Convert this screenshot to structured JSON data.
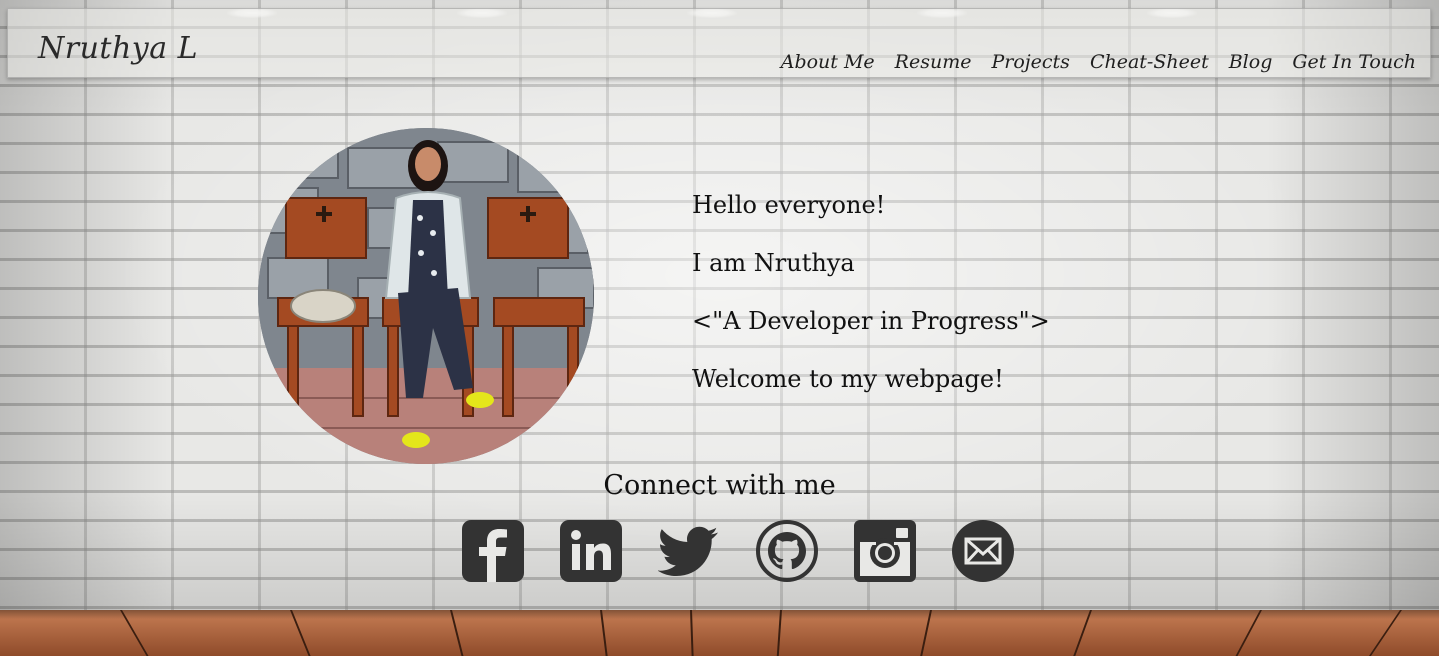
{
  "header": {
    "brand": "Nruthya L",
    "nav": [
      "About Me",
      "Resume",
      "Projects",
      "Cheat-Sheet",
      "Blog",
      "Get In Touch"
    ]
  },
  "intro": {
    "lines": [
      "Hello everyone!",
      "I am Nruthya",
      "<\"A Developer in Progress\">",
      "Welcome to my webpage!"
    ]
  },
  "connect": {
    "title": "Connect with me",
    "icons": [
      "facebook-icon",
      "linkedin-icon",
      "twitter-icon",
      "github-icon",
      "instagram-icon",
      "email-icon"
    ]
  },
  "colors": {
    "icon": "#333333",
    "text": "#111111"
  }
}
